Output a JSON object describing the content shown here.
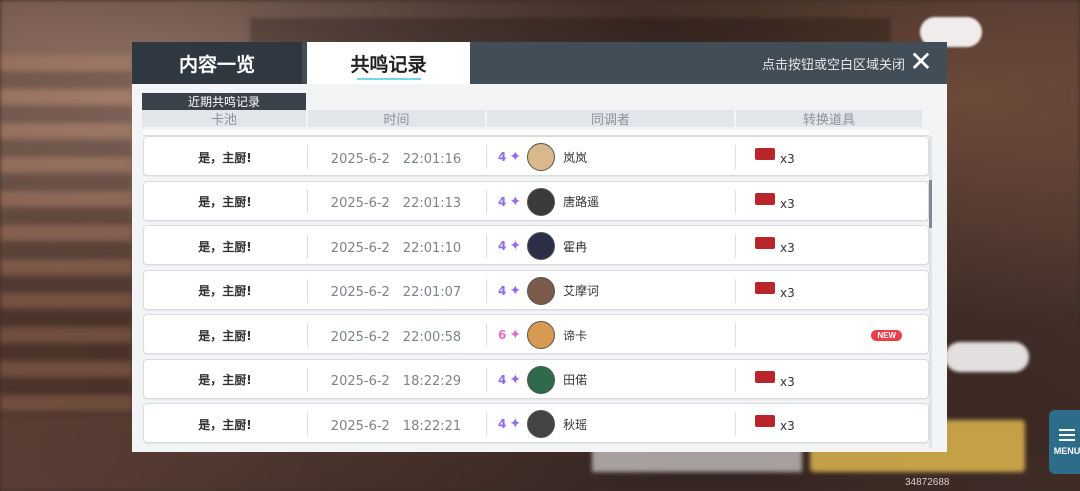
{
  "dialog": {
    "tabs": [
      {
        "label": "内容一览"
      },
      {
        "label": "共鸣记录"
      }
    ],
    "close_hint": "点击按钮或空白区域关闭",
    "close_icon": "✕",
    "section_title": "近期共鸣记录",
    "columns": [
      "卡池",
      "时间",
      "同调者",
      "转换道具"
    ],
    "rows": [
      {
        "pool": "是，主厨!",
        "time": "2025-6-2　22:01:16",
        "rarity": "4",
        "name": "岚岚",
        "item_qty": "x3",
        "avatar_color": "#d8b88c"
      },
      {
        "pool": "是，主厨!",
        "time": "2025-6-2　22:01:13",
        "rarity": "4",
        "name": "唐路遥",
        "item_qty": "x3",
        "avatar_color": "#3a3a3a"
      },
      {
        "pool": "是，主厨!",
        "time": "2025-6-2　22:01:10",
        "rarity": "4",
        "name": "霍冉",
        "item_qty": "x3",
        "avatar_color": "#2c2f45"
      },
      {
        "pool": "是，主厨!",
        "time": "2025-6-2　22:01:07",
        "rarity": "4",
        "name": "艾摩诃",
        "item_qty": "x3",
        "avatar_color": "#7a5a48"
      },
      {
        "pool": "是，主厨!",
        "time": "2025-6-2　22:00:58",
        "rarity": "6",
        "name": "谛卡",
        "item_qty": "",
        "new_badge": "NEW",
        "avatar_color": "#d89a52"
      },
      {
        "pool": "是，主厨!",
        "time": "2025-6-2　18:22:29",
        "rarity": "4",
        "name": "田偌",
        "item_qty": "x3",
        "avatar_color": "#2f6a4c"
      },
      {
        "pool": "是，主厨!",
        "time": "2025-6-2　18:22:21",
        "rarity": "4",
        "name": "秋瑶",
        "item_qty": "x3",
        "avatar_color": "#444"
      }
    ]
  },
  "menu_label": "MENU",
  "uid": "34872688",
  "colors": {
    "rarity4": "#8f6cf0",
    "rarity6": "#e86bc9",
    "ticket": "#b8262b",
    "new_badge": "#e8404a",
    "menu": "#2e6d8a"
  }
}
